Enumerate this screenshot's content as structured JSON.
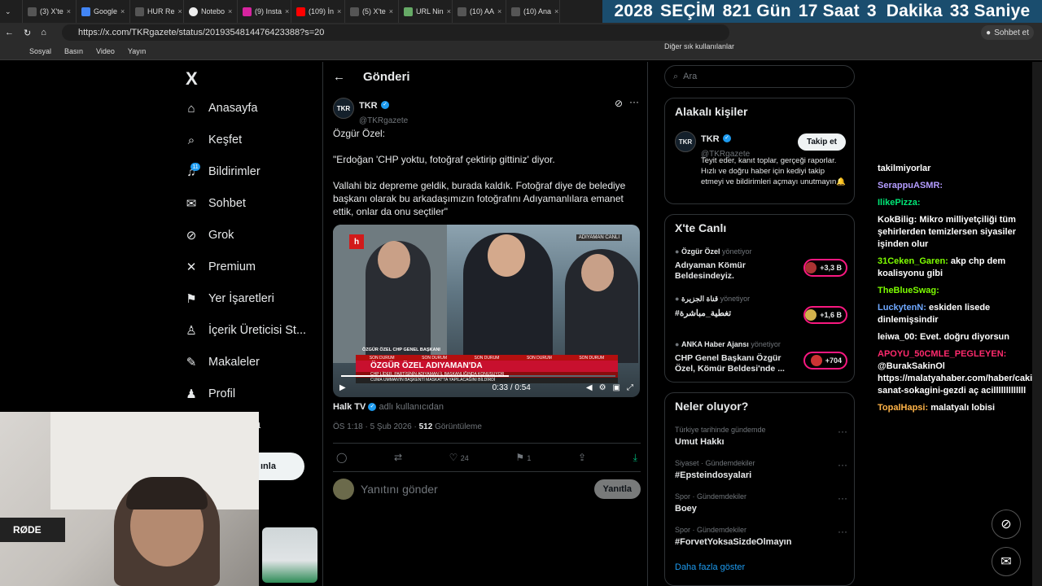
{
  "browser": {
    "tabs": [
      "(3) X'te",
      "Google",
      "HUR Re",
      "Notebo",
      "(9) Insta",
      "(109) İn",
      "(5) X'te",
      "URL Nin",
      "(10) AA",
      "(10) Ana"
    ],
    "url": "https://x.com/TKRgazete/status/2019354814476423388?s=20",
    "sohbet_label": "Sohbet et",
    "bookmarks": [
      "Sosyal",
      "Basın",
      "Video",
      "Yayın"
    ],
    "bookmarks_other": "Diğer sık kullanılanlar"
  },
  "countdown": {
    "year": "2028",
    "label": "SEÇİM",
    "days": "821 Gün",
    "hours": "17 Saat",
    "minutes": "3  Dakika",
    "seconds": "33 Saniye"
  },
  "nav": {
    "logo": "X",
    "items": [
      "Anasayfa",
      "Keşfet",
      "Bildirimler",
      "Sohbet",
      "Grok",
      "Premium",
      "Yer İşaretleri",
      "İçerik Üreticisi St...",
      "Makaleler",
      "Profil"
    ],
    "notif_count": "11",
    "post_button_partial": "ınla",
    "partial_item": "a"
  },
  "post": {
    "header": "Gönderi",
    "author_name": "TKR",
    "author_handle": "@TKRgazete",
    "avatar_text": "TKR",
    "text": [
      "Özgür Özel:",
      "\"Erdoğan 'CHP yoktu, fotoğraf çektirip gittiniz' diyor.",
      "Vallahi biz depreme geldik, burada kaldık. Fotoğraf diye de belediye başkanı olarak bu arkadaşımızın fotoğrafını Adıyamanlılara emanet ettik, onlar da onu seçtiler\""
    ],
    "video": {
      "channel_logo": "h",
      "location_tag": "ADIYAMAN  CANLI",
      "speaker_tag": "ÖZGÜR ÖZEL   CHP GENEL BAŞKANI",
      "strip_labels": [
        "SON DURUM",
        "SON DURUM",
        "SON DURUM",
        "SON DURUM",
        "SON DURUM"
      ],
      "headline": "ÖZGÜR ÖZEL ADIYAMAN'DA",
      "subheadline": "CHP LİDER, PARTİSİNİN ADIYAMAN İL BAŞKANLIĞINDA KONUŞUYOR",
      "ticker": "CUMA UMMAN'IN BAŞKENTİ MASKAT'TA YAPILACAĞINI BİLDİRDİ",
      "time": "0:33 / 0:54",
      "progress": 0.61
    },
    "source_name": "Halk TV",
    "source_suffix": "adlı kullanıcıdan",
    "timestamp": "ÖS 1:18 · 5 Şub 2026 ·",
    "views": "512",
    "views_label": "Görüntüleme",
    "likes": "24",
    "bookmarks": "1",
    "reply_placeholder": "Yanıtını gönder",
    "reply_button": "Yanıtla"
  },
  "sidebar": {
    "search_placeholder": "Ara",
    "related_title": "Alakalı kişiler",
    "related": {
      "name": "TKR",
      "handle": "@TKRgazete",
      "bio": "Teyit eder, kanıt toplar, gerçeği raporlar. Hızlı ve doğru haber için kediyi takip etmeyi ve bildirimleri açmayı unutmayın🔔",
      "follow": "Takip et"
    },
    "live_title": "X'te Canlı",
    "live": [
      {
        "who": "Özgür Özel",
        "role": "yönetiyor",
        "text": "Adıyaman Kömür Beldesindeyiz.",
        "count": "+3,3 B"
      },
      {
        "who": "قناة الجزيرة",
        "role": "yönetiyor",
        "text": "#تغطية_مباشرة",
        "count": "+1,6 B"
      },
      {
        "who": "ANKA Haber Ajansı",
        "role": "yönetiyor",
        "text": "CHP Genel Başkanı Özgür Özel, Kömür Beldesi'nde ...",
        "count": "+704"
      }
    ],
    "trends_title": "Neler oluyor?",
    "trends": [
      {
        "cat": "Türkiye tarihinde gündemde",
        "title": "Umut Hakkı"
      },
      {
        "cat": "Siyaset · Gündemdekiler",
        "title": "#Epsteindosyalari"
      },
      {
        "cat": "Spor · Gündemdekiler",
        "title": "Boey"
      },
      {
        "cat": "Spor · Gündemdekiler",
        "title": "#ForvetYoksaSizdeOlmayın"
      }
    ],
    "show_more": "Daha fazla göster"
  },
  "chat": [
    {
      "user": "",
      "msg": "takilmiyorlar",
      "color": "#ffffff"
    },
    {
      "user": "SerappuASMR",
      "msg": "",
      "color": "#b39cff"
    },
    {
      "user": "IlikePizza",
      "msg": "",
      "color": "#00e676"
    },
    {
      "user": "KokBilig",
      "msg": "Mikro milliyetçiliği tüm şehirlerden temizlersen siyasiler işinden olur",
      "color": "#ffffff"
    },
    {
      "user": "31Ceken_Garen",
      "msg": "akp chp dem koalisyonu gibi",
      "color": "#7fff00"
    },
    {
      "user": "TheBlueSwag",
      "msg": "",
      "color": "#7cfc00"
    },
    {
      "user": "LuckytenN",
      "msg": "eskiden lisede dinlemişsindir",
      "color": "#6fa8ff"
    },
    {
      "user": "leiwa_00",
      "msg": "Evet. doğru diyorsun",
      "color": "#ffffff"
    },
    {
      "user": "APOYU_50CMLE_PEGLEYEN",
      "msg": "@BurakSakinOl https://malatyahaber.com/haber/cakir-sanat-sokagini-gezdi aç acilllllllllllll",
      "color": "#ff2a6d"
    },
    {
      "user": "TopalHapsi",
      "msg": "malatyalı lobisi",
      "color": "#ffb347"
    }
  ],
  "webcam": {
    "mic_brand": "RØDE"
  }
}
